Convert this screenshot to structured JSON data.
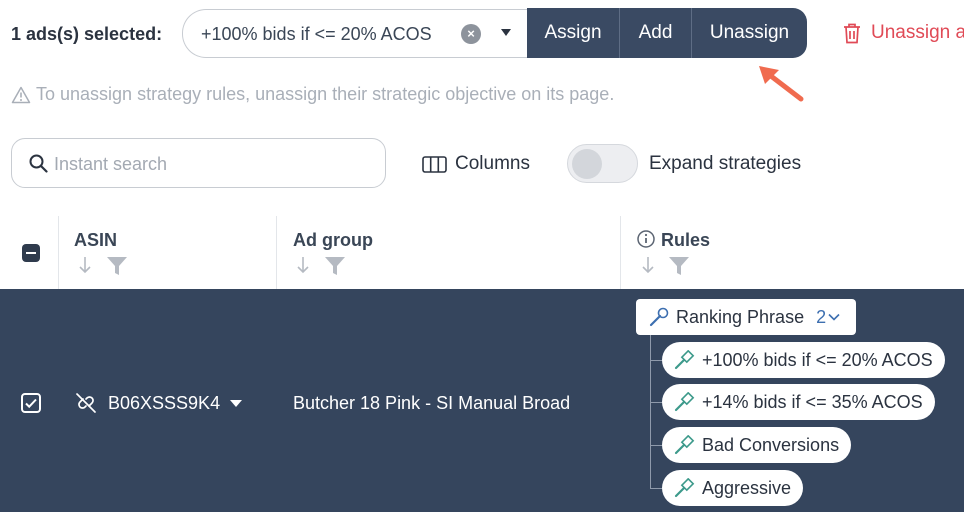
{
  "toolbar": {
    "selection_label": "1 ads(s) selected:",
    "strategy_value": "+100% bids if <= 20% ACOS",
    "assign_label": "Assign",
    "add_label": "Add",
    "unassign_label": "Unassign",
    "unassign_all_label": "Unassign a"
  },
  "warning": "To unassign strategy rules, unassign their strategic objective on its page.",
  "search": {
    "placeholder": "Instant search"
  },
  "columns_label": "Columns",
  "expand_label": "Expand strategies",
  "table": {
    "headers": {
      "asin": "ASIN",
      "ad_group": "Ad group",
      "rules": "Rules"
    },
    "rows": [
      {
        "asin": "B06XSSS9K4",
        "ad_group": "Butcher 18 Pink - SI Manual Broad",
        "strategy": {
          "name": "Ranking Phrase",
          "count": "2"
        },
        "rules": [
          "+100% bids if <= 20% ACOS",
          "+14% bids if <= 35% ACOS",
          "Bad Conversions",
          "Aggressive"
        ]
      }
    ]
  },
  "colors": {
    "row_bg": "#35455d",
    "accent_red": "#e04a56",
    "button_bg": "#3a4a63",
    "arrow": "#f06b4f"
  }
}
